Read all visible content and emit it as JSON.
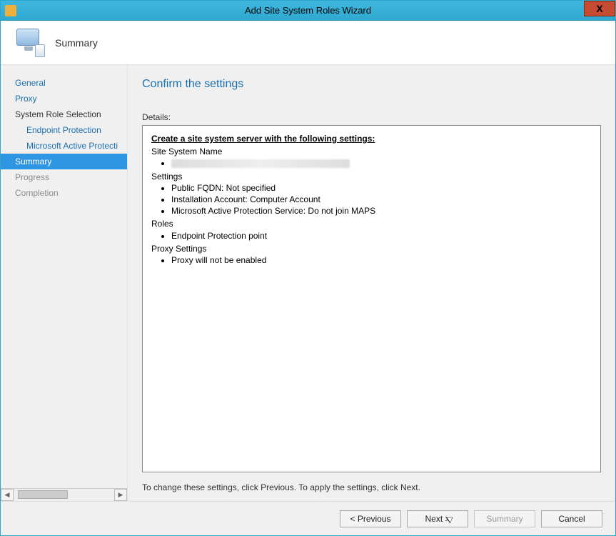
{
  "window": {
    "title": "Add Site System Roles Wizard"
  },
  "header": {
    "title": "Summary"
  },
  "sidebar": {
    "items": [
      {
        "label": "General",
        "type": "link"
      },
      {
        "label": "Proxy",
        "type": "link"
      },
      {
        "label": "System Role Selection",
        "type": "plain"
      },
      {
        "label": "Endpoint Protection",
        "type": "sub-link"
      },
      {
        "label": "Microsoft Active Protecti",
        "type": "sub-link"
      },
      {
        "label": "Summary",
        "type": "selected"
      },
      {
        "label": "Progress",
        "type": "disabled"
      },
      {
        "label": "Completion",
        "type": "disabled"
      }
    ]
  },
  "main": {
    "heading": "Confirm the settings",
    "details_label": "Details:",
    "details": {
      "title": "Create a site system server with the following settings:",
      "site_system_name_label": "Site System Name",
      "site_system_name_value": "[redacted]",
      "settings_label": "Settings",
      "settings": [
        "Public FQDN: Not specified",
        "Installation Account: Computer Account",
        "Microsoft Active Protection Service: Do not join MAPS"
      ],
      "roles_label": "Roles",
      "roles": [
        "Endpoint Protection point"
      ],
      "proxy_label": "Proxy Settings",
      "proxy": [
        "Proxy will not be enabled"
      ]
    },
    "hint": "To change these settings, click Previous. To apply the settings, click Next."
  },
  "buttons": {
    "previous": "< Previous",
    "next": "Next >",
    "summary": "Summary",
    "cancel": "Cancel"
  }
}
